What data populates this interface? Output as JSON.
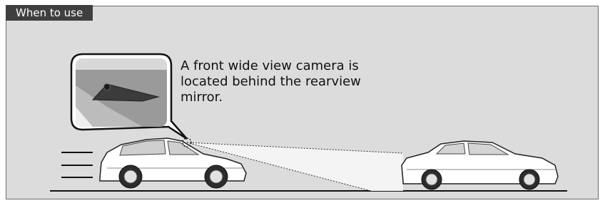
{
  "section": {
    "tab_label": "When to use",
    "caption": "A front wide view camera is\nlocated behind the rearview\nmirror."
  },
  "colors": {
    "panel_background": "#dcdcdc",
    "tab_background": "#3f3f3f",
    "tab_text": "#ffffff",
    "beam": "#f2f2f2",
    "car": "#ffffff",
    "outline": "#222222"
  },
  "icons": {
    "camera": "camera-icon",
    "callout": "magnified-view-callout"
  }
}
